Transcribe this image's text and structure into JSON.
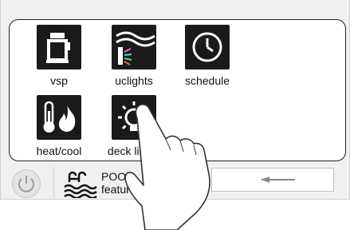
{
  "tiles": [
    {
      "label": "vsp",
      "icon": "pump-icon"
    },
    {
      "label": "uclights",
      "icon": "lights-icon"
    },
    {
      "label": "schedule",
      "icon": "clock-icon"
    },
    {
      "label": "heat/cool",
      "icon": "heat-cool-icon"
    },
    {
      "label": "deck lights",
      "icon": "bulb-icon"
    }
  ],
  "bottom_bar": {
    "pool_label": "POOL",
    "features_label": "features"
  },
  "colors": {
    "tile_bg": "#1a1a1a",
    "panel_border": "#222222",
    "bar_bg": "#f0f0f0"
  }
}
